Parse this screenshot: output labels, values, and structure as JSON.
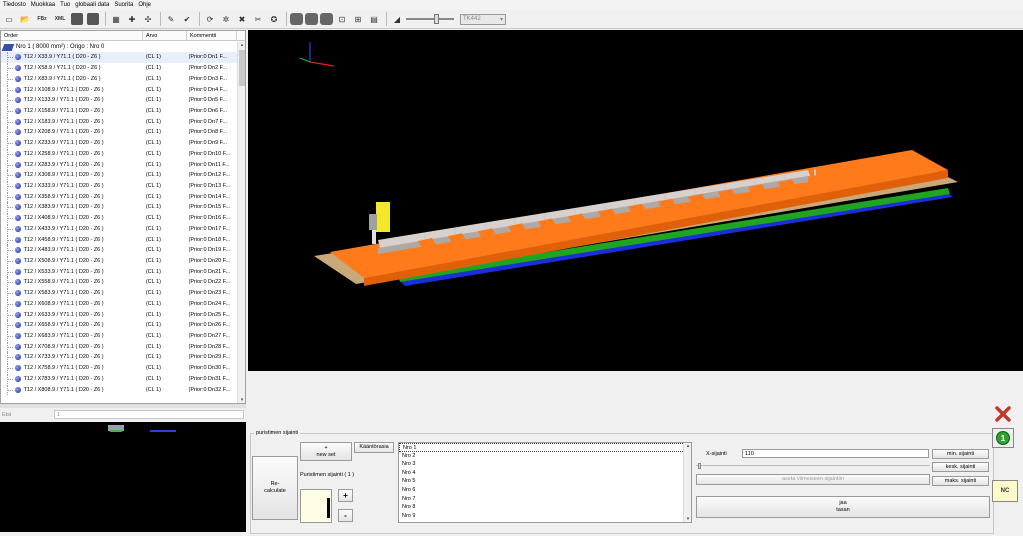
{
  "menu": [
    "Tiedosto",
    "Muokkaa",
    "Tuo",
    "globaali data",
    "Suorita",
    "Ohje"
  ],
  "toolbar": {
    "fbz": "FBz",
    "xml": "XML",
    "combo_value": "TK442"
  },
  "tree": {
    "headers": {
      "order": "Order",
      "arvo": "Arvo",
      "kommentti": "Kommentti"
    },
    "root": "Nro 1 ( 8000 mm²) : Origo : Nro 0",
    "rows": [
      {
        "order": "T12 / X33.9 / Y71.1  ( D20 - Z6 )",
        "arvo": "(CL 1)",
        "komm": "(Prior:0 Dn1 F..."
      },
      {
        "order": "T12 / X58.9 / Y71.1  ( D20 - Z6 )",
        "arvo": "(CL 1)",
        "komm": "(Prior:0 Dn2 F..."
      },
      {
        "order": "T12 / X83.9 / Y71.1  ( D20 - Z6 )",
        "arvo": "(CL 1)",
        "komm": "(Prior:0 Dn3 F..."
      },
      {
        "order": "T12 / X108.9 / Y71.1  ( D20 - Z6 )",
        "arvo": "(CL 1)",
        "komm": "(Prior:0 Dn4 F..."
      },
      {
        "order": "T12 / X133.9 / Y71.1  ( D20 - Z6 )",
        "arvo": "(CL 1)",
        "komm": "(Prior:0 Dn5 F..."
      },
      {
        "order": "T12 / X158.9 / Y71.1  ( D20 - Z6 )",
        "arvo": "(CL 1)",
        "komm": "(Prior:0 Dn6 F..."
      },
      {
        "order": "T12 / X183.9 / Y71.1  ( D20 - Z6 )",
        "arvo": "(CL 1)",
        "komm": "(Prior:0 Dn7 F..."
      },
      {
        "order": "T12 / X208.9 / Y71.1  ( D20 - Z6 )",
        "arvo": "(CL 1)",
        "komm": "(Prior:0 Dn8 F..."
      },
      {
        "order": "T12 / X233.9 / Y71.1  ( D20 - Z6 )",
        "arvo": "(CL 1)",
        "komm": "(Prior:0 Dn9 F..."
      },
      {
        "order": "T12 / X258.9 / Y71.1  ( D20 - Z6 )",
        "arvo": "(CL 1)",
        "komm": "(Prior:0 Dn10 F..."
      },
      {
        "order": "T12 / X283.9 / Y71.1  ( D20 - Z6 )",
        "arvo": "(CL 1)",
        "komm": "(Prior:0 Dn11 F..."
      },
      {
        "order": "T12 / X308.9 / Y71.1  ( D20 - Z6 )",
        "arvo": "(CL 1)",
        "komm": "(Prior:0 Dn12 F..."
      },
      {
        "order": "T12 / X333.9 / Y71.1  ( D20 - Z6 )",
        "arvo": "(CL 1)",
        "komm": "(Prior:0 Dn13 F..."
      },
      {
        "order": "T12 / X358.9 / Y71.1  ( D20 - Z6 )",
        "arvo": "(CL 1)",
        "komm": "(Prior:0 Dn14 F..."
      },
      {
        "order": "T12 / X383.9 / Y71.1  ( D20 - Z6 )",
        "arvo": "(CL 1)",
        "komm": "(Prior:0 Dn15 F..."
      },
      {
        "order": "T12 / X408.9 / Y71.1  ( D20 - Z6 )",
        "arvo": "(CL 1)",
        "komm": "(Prior:0 Dn16 F..."
      },
      {
        "order": "T12 / X433.9 / Y71.1  ( D20 - Z6 )",
        "arvo": "(CL 1)",
        "komm": "(Prior:0 Dn17 F..."
      },
      {
        "order": "T12 / X458.9 / Y71.1  ( D20 - Z6 )",
        "arvo": "(CL 1)",
        "komm": "(Prior:0 Dn18 F..."
      },
      {
        "order": "T12 / X483.9 / Y71.1  ( D20 - Z6 )",
        "arvo": "(CL 1)",
        "komm": "(Prior:0 Dn19 F..."
      },
      {
        "order": "T12 / X508.9 / Y71.1  ( D20 - Z6 )",
        "arvo": "(CL 1)",
        "komm": "(Prior:0 Dn20 F..."
      },
      {
        "order": "T12 / X533.9 / Y71.1  ( D20 - Z6 )",
        "arvo": "(CL 1)",
        "komm": "(Prior:0 Dn21 F..."
      },
      {
        "order": "T12 / X558.9 / Y71.1  ( D20 - Z6 )",
        "arvo": "(CL 1)",
        "komm": "(Prior:0 Dn22 F..."
      },
      {
        "order": "T12 / X583.9 / Y71.1  ( D20 - Z6 )",
        "arvo": "(CL 1)",
        "komm": "(Prior:0 Dn23 F..."
      },
      {
        "order": "T12 / X608.9 / Y71.1  ( D20 - Z6 )",
        "arvo": "(CL 1)",
        "komm": "(Prior:0 Dn24 F..."
      },
      {
        "order": "T12 / X633.9 / Y71.1  ( D20 - Z6 )",
        "arvo": "(CL 1)",
        "komm": "(Prior:0 Dn25 F..."
      },
      {
        "order": "T12 / X658.9 / Y71.1  ( D20 - Z6 )",
        "arvo": "(CL 1)",
        "komm": "(Prior:0 Dn26 F..."
      },
      {
        "order": "T12 / X683.9 / Y71.1  ( D20 - Z6 )",
        "arvo": "(CL 1)",
        "komm": "(Prior:0 Dn27 F..."
      },
      {
        "order": "T12 / X708.9 / Y71.1  ( D20 - Z6 )",
        "arvo": "(CL 1)",
        "komm": "(Prior:0 Dn28 F..."
      },
      {
        "order": "T12 / X733.9 / Y71.1  ( D20 - Z6 )",
        "arvo": "(CL 1)",
        "komm": "(Prior:0 Dn29 F..."
      },
      {
        "order": "T12 / X758.9 / Y71.1  ( D20 - Z6 )",
        "arvo": "(CL 1)",
        "komm": "(Prior:0 Dn30 F..."
      },
      {
        "order": "T12 / X783.9 / Y71.1  ( D20 - Z6 )",
        "arvo": "(CL 1)",
        "komm": "(Prior:0 Dn31 F..."
      },
      {
        "order": "T12 / X808.9 / Y71.1  ( D20 - Z6 )",
        "arvo": "(CL 1)",
        "komm": "(Prior:0 Dn32 F..."
      }
    ]
  },
  "search": {
    "label": "Etsi",
    "value": "1"
  },
  "bottom": {
    "group_title": "puristimen sijainti",
    "recalculate": "Re-\ncalculate",
    "new_set": "+\nnew set",
    "kaantorasia": "Kääntörasia",
    "position_label": "Puristimen sijainti ( 1 )",
    "plus": "+",
    "minus": "-",
    "list_items": [
      "Nro 1",
      "Nro 2",
      "Nro 3",
      "Nro 4",
      "Nro 5",
      "Nro 6",
      "Nro 7",
      "Nro 8",
      "Nro 9"
    ],
    "x_label": "X-sijainti",
    "x_value": "110",
    "aseta": "aseta viimeiseen sijaintiin",
    "jaa_tasan": "jaa\ntasan",
    "min_sijainti": "min. sijainti",
    "kesk_sijainti": "kesk. sijainti",
    "maks_sijainti": "maks. sijainti"
  },
  "side": {
    "close_icon_color": "#c0392b",
    "badge_number": "1",
    "nc_label": "NC"
  },
  "colors": {
    "orange": "#ff7a1a",
    "green": "#1fa51f",
    "blue": "#1a2fd8",
    "yellow": "#f5e82a",
    "tan": "#c9a87a"
  }
}
